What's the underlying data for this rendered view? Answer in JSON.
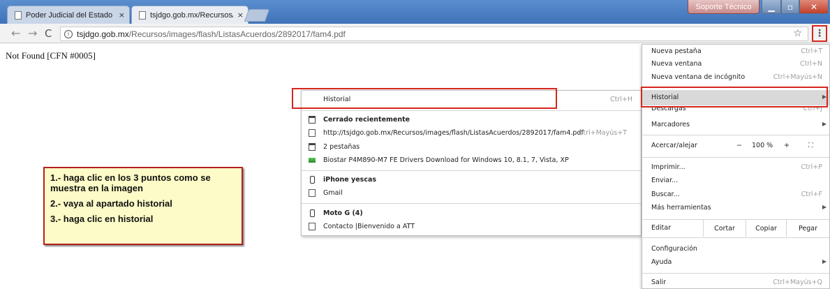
{
  "tabs": [
    {
      "title": "Poder Judicial del Estado",
      "close": "×"
    },
    {
      "title": "tsjdgo.gob.mx/Recursos/",
      "close": "×"
    }
  ],
  "window": {
    "support_label": "Soporte Técnico"
  },
  "toolbar": {
    "back": "←",
    "forward": "→",
    "reload": "C",
    "url_domain": "tsjdgo.gob.mx",
    "url_path": "/Recursos/images/flash/ListasAcuerdos/2892017/fam4.pdf",
    "star": "☆",
    "menu": "⋮"
  },
  "page": {
    "message": "Not Found [CFN #0005]"
  },
  "instructions": [
    "1.- haga clic en los 3 puntos como se muestra en la imagen",
    "2.- vaya al apartado historial",
    "3.- haga clic en historial"
  ],
  "history_menu": {
    "historial": {
      "label": "Historial",
      "shortcut": "Ctrl+H"
    },
    "recently_closed_header": "Cerrado recientemente",
    "recent_url": "http://tsjdgo.gob.mx/Recursos/images/flash/ListasAcuerdos/2892017/fam4.pdf",
    "recent_url_shortcut": "Ctrl+Mayús+T",
    "two_tabs": "2 pestañas",
    "biostar": "Biostar P4M890-M7 FE Drivers Download for Windows 10, 8.1, 7, Vista, XP",
    "device1": "iPhone yescas",
    "device1_item": "Gmail",
    "device2": "Moto G (4)",
    "device2_item": "Contacto |Bienvenido a ATT"
  },
  "main_menu": {
    "new_tab": {
      "label": "Nueva pestaña",
      "shortcut": "Ctrl+T"
    },
    "new_window": {
      "label": "Nueva ventana",
      "shortcut": "Ctrl+N"
    },
    "incognito": {
      "label": "Nueva ventana de incógnito",
      "shortcut": "Ctrl+Mayús+N"
    },
    "history": {
      "label": "Historial"
    },
    "downloads": {
      "label": "Descargas",
      "shortcut": "Ctrl+J"
    },
    "bookmarks": {
      "label": "Marcadores"
    },
    "zoom": {
      "label": "Acercar/alejar",
      "minus": "−",
      "value": "100 %",
      "plus": "+",
      "fullscreen": "⛶"
    },
    "print": {
      "label": "Imprimir...",
      "shortcut": "Ctrl+P"
    },
    "send": {
      "label": "Enviar..."
    },
    "find": {
      "label": "Buscar...",
      "shortcut": "Ctrl+F"
    },
    "more_tools": {
      "label": "Más herramientas"
    },
    "edit": {
      "label": "Editar",
      "cut": "Cortar",
      "copy": "Copiar",
      "paste": "Pegar"
    },
    "settings": {
      "label": "Configuración"
    },
    "help": {
      "label": "Ayuda"
    },
    "exit": {
      "label": "Salir",
      "shortcut": "Ctrl+Mayús+Q"
    }
  },
  "colors": {
    "highlight_red": "#d6261c",
    "callout_bg": "#fdfbc7",
    "titlebar": "#4a7fc3"
  },
  "icons": [
    "document-icon",
    "info-icon",
    "star-icon",
    "kebab-menu-icon",
    "submenu-arrow-icon",
    "tab-icon",
    "phone-icon",
    "fullscreen-icon"
  ]
}
